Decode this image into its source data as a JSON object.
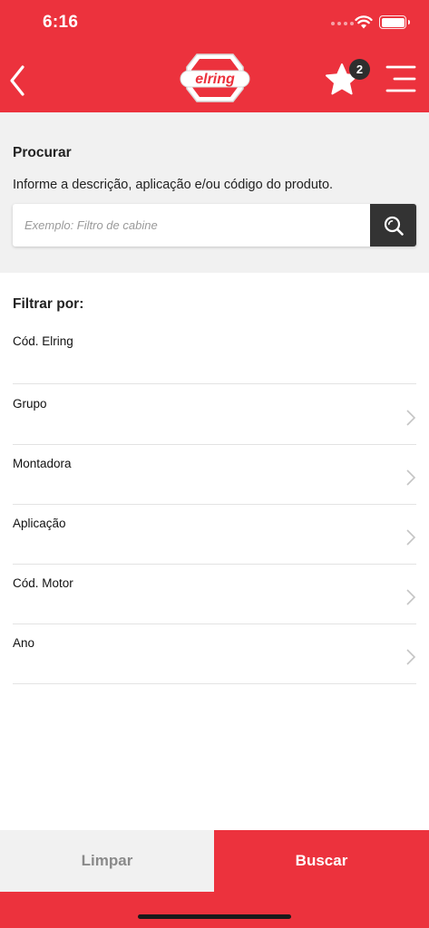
{
  "status_bar": {
    "time": "6:16"
  },
  "header": {
    "logo_text": "elring",
    "favorites_count": "2",
    "icons": {
      "back": "chevron-left-icon",
      "favorites": "star-icon",
      "menu": "menu-icon"
    }
  },
  "search": {
    "title": "Procurar",
    "description": "Informe a descrição, aplicação e/ou código do produto.",
    "placeholder": "Exemplo: Filtro de cabine",
    "value": "",
    "button_icon": "search-icon"
  },
  "filters": {
    "title": "Filtrar por:",
    "items": [
      {
        "label": "Cód. Elring",
        "has_chevron": false
      },
      {
        "label": "Grupo",
        "has_chevron": true
      },
      {
        "label": "Montadora",
        "has_chevron": true
      },
      {
        "label": "Aplicação",
        "has_chevron": true
      },
      {
        "label": "Cód. Motor",
        "has_chevron": true
      },
      {
        "label": "Ano",
        "has_chevron": true
      }
    ]
  },
  "actions": {
    "clear_label": "Limpar",
    "search_label": "Buscar"
  },
  "colors": {
    "brand_red": "#ec323d",
    "dark": "#333333",
    "light_gray": "#f1f1f1"
  }
}
